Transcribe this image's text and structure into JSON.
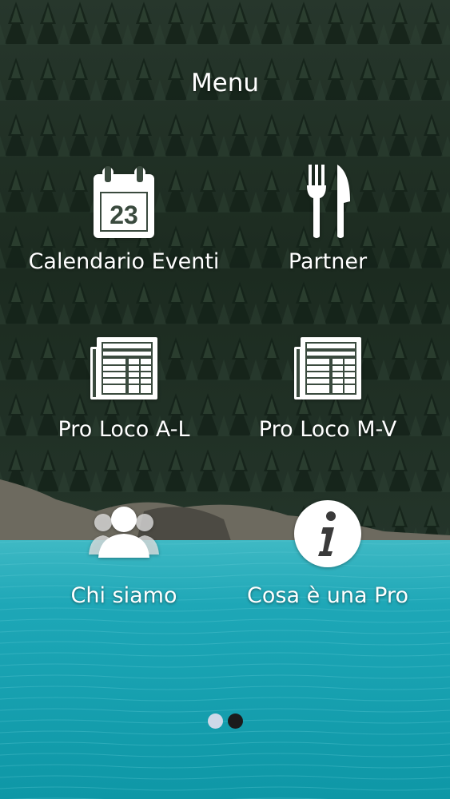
{
  "header": {
    "title": "Menu"
  },
  "menu": {
    "items": [
      {
        "label": "Calendario Eventi",
        "icon": "calendar-icon",
        "calendar_day": "23"
      },
      {
        "label": "Partner",
        "icon": "fork-knife-icon"
      },
      {
        "label": "Pro Loco A-L",
        "icon": "newspaper-icon"
      },
      {
        "label": "Pro Loco M-V",
        "icon": "newspaper-icon"
      },
      {
        "label": "Chi siamo",
        "icon": "users-icon"
      },
      {
        "label": "Cosa è una Pro",
        "icon": "info-icon"
      }
    ]
  },
  "pager": {
    "pages": 2,
    "current": 1,
    "active_color": "#cfd8e8",
    "inactive_color": "#1b1b1b"
  },
  "theme": {
    "icon_color": "#ffffff",
    "forest_dark": "#1a2b20",
    "lake_color": "#1aa3b3"
  }
}
